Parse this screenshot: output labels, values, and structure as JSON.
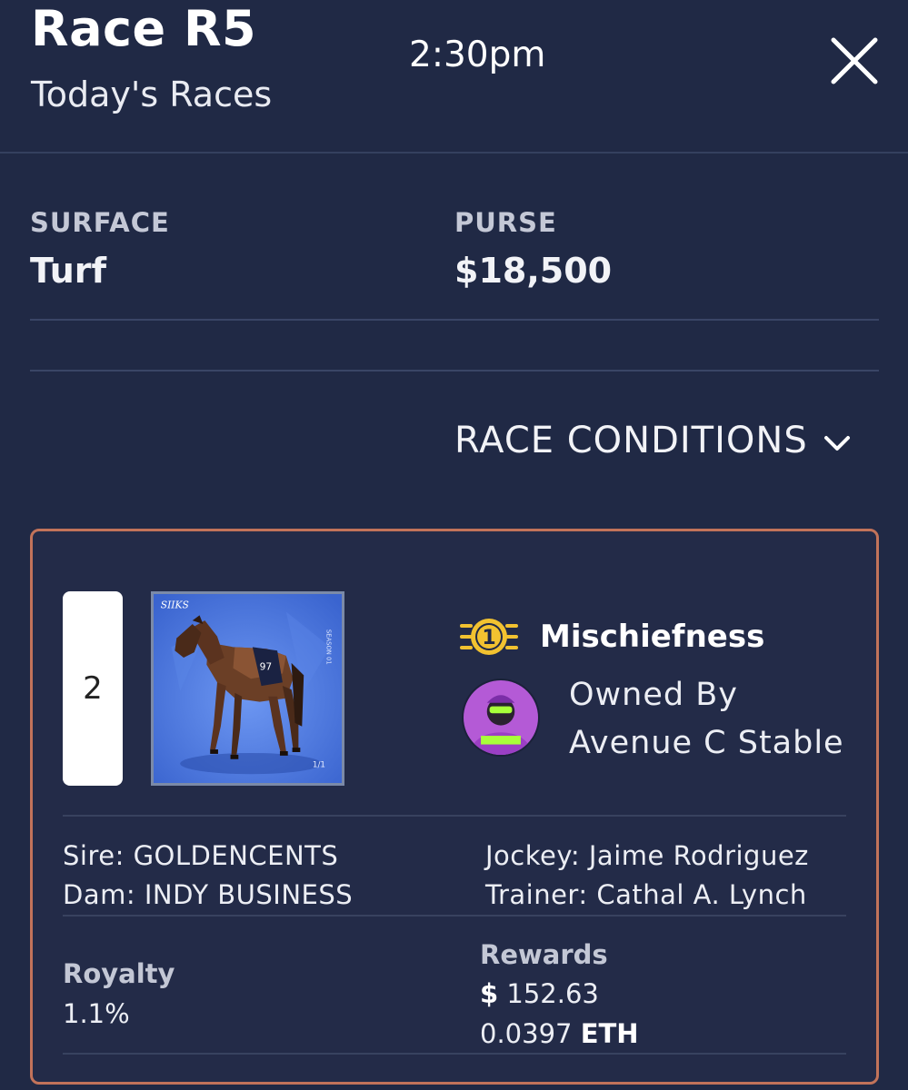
{
  "header": {
    "title": "Race R5",
    "subtitle": "Today's Races",
    "time": "2:30pm"
  },
  "info": {
    "surface_label": "SURFACE",
    "surface_value": "Turf",
    "purse_label": "PURSE",
    "purse_value": "$18,500"
  },
  "conditions": {
    "label": "RACE CONDITIONS"
  },
  "entry": {
    "post_number": "2",
    "card_brand": "SIIKS",
    "card_season": "SEASON 01",
    "card_edition": "1/1",
    "saddle_number": "97",
    "placement": "1",
    "horse_name": "Mischiefness",
    "owned_by_label": "Owned By",
    "owner_name": "Avenue C Stable",
    "sire": "Sire: GOLDENCENTS",
    "dam": "Dam: INDY BUSINESS",
    "jockey": "Jockey: Jaime Rodriguez",
    "trainer": "Trainer: Cathal A. Lynch",
    "royalty_label": "Royalty",
    "royalty_value": "1.1%",
    "rewards_label": "Rewards",
    "rewards_currency_symbol": "$",
    "rewards_usd": "152.63",
    "rewards_eth_amount": "0.0397",
    "rewards_eth_unit": "ETH"
  },
  "icons": {
    "close": "close-icon",
    "chevron": "chevron-down-icon",
    "medal": "first-place-medal-icon",
    "avatar": "owner-avatar"
  },
  "colors": {
    "background": "#202945",
    "card_border": "#c2735a",
    "medal": "#f2c230",
    "avatar_bg": "#b45ad6",
    "avatar_accent": "#a8ff3a"
  }
}
